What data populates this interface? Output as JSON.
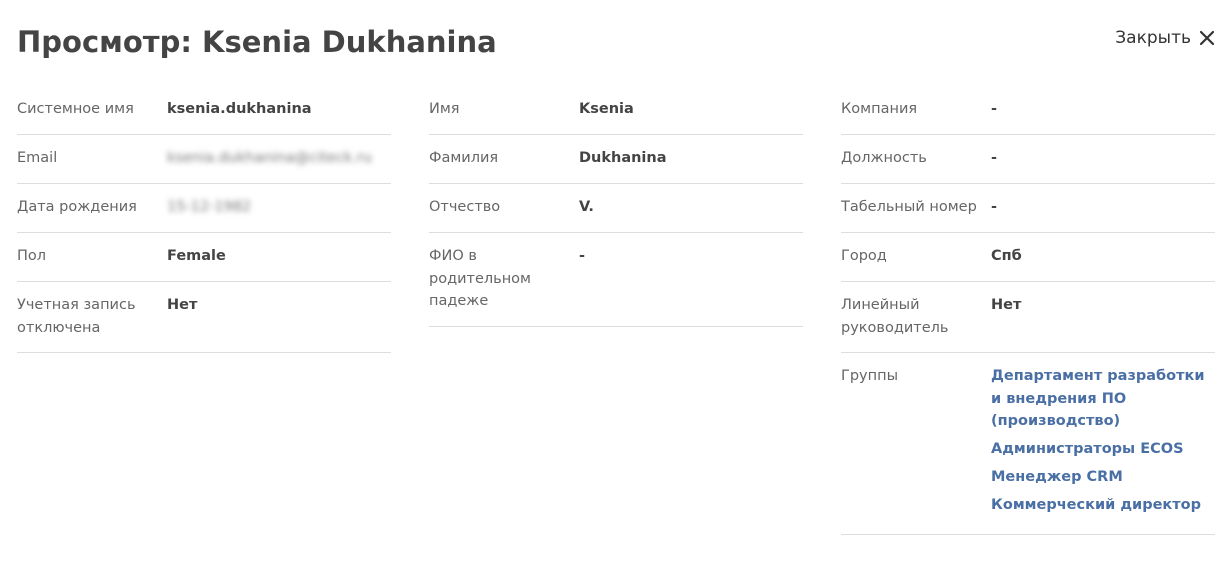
{
  "header": {
    "title": "Просмотр: Ksenia Dukhanina",
    "close_label": "Закрыть"
  },
  "column1": [
    {
      "label": "Системное имя",
      "value": "ksenia.dukhanina"
    },
    {
      "label": "Email",
      "value": "ksenia.dukhanina@citeck.ru",
      "blurred": true
    },
    {
      "label": "Дата рождения",
      "value": "15-12-1982",
      "blurred": true
    },
    {
      "label": "Пол",
      "value": "Female"
    },
    {
      "label": "Учетная запись отключена",
      "value": "Нет"
    }
  ],
  "column2": [
    {
      "label": "Имя",
      "value": "Ksenia"
    },
    {
      "label": "Фамилия",
      "value": "Dukhanina"
    },
    {
      "label": "Отчество",
      "value": "V."
    },
    {
      "label": "ФИО в родительном падеже",
      "value": "-"
    }
  ],
  "column3": [
    {
      "label": "Компания",
      "value": "-"
    },
    {
      "label": "Должность",
      "value": "-"
    },
    {
      "label": "Табельный номер",
      "value": "-"
    },
    {
      "label": "Город",
      "value": "Спб"
    },
    {
      "label": "Линейный руководитель",
      "value": "Нет"
    }
  ],
  "groups": {
    "label": "Группы",
    "items": [
      "Департамент разработки и внедрения ПО (производство)",
      "Администраторы ECOS",
      "Менеджер CRM",
      "Коммерческий директор"
    ]
  },
  "colors": {
    "link": "#4a6fa5",
    "text": "#444444",
    "label": "#666666",
    "divider": "#dddddd"
  }
}
